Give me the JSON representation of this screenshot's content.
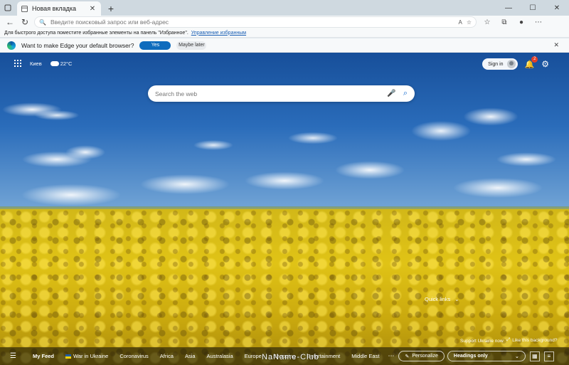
{
  "browser": {
    "tab_title": "Новая вкладка",
    "address_placeholder": "Введите поисковый запрос или веб-адрес",
    "favorites_hint": "Для быстрого доступа поместите избранные элементы на панель \"Избранное\".",
    "favorites_link": "Управление избранным"
  },
  "default_prompt": {
    "text": "Want to make Edge your default browser?",
    "yes_label": "Yes",
    "later_label": "Maybe later"
  },
  "ntp": {
    "city": "Киев",
    "temperature": "22°C",
    "signin_label": "Sign in",
    "notification_count": "2",
    "search_placeholder": "Search the web",
    "quick_links": "Quick links",
    "support_text": "Support Ukraine now",
    "like_bg_text": "Like this background?"
  },
  "feed": {
    "tabs": [
      "My Feed",
      "War in Ukraine",
      "Coronavirus",
      "Africa",
      "Asia",
      "Australasia",
      "Europe",
      "Shopping",
      "Entertainment",
      "Middle East"
    ],
    "personalize_label": "Personalize",
    "headings_value": "Headings only"
  },
  "watermark": "NaName-Club",
  "icons": {
    "back": "back-arrow-icon",
    "reload": "reload-icon",
    "info": "info-icon",
    "read_aloud": "read-aloud-icon",
    "favorite": "star-icon",
    "apps": "apps-grid-icon",
    "weather": "partly-cloudy-icon",
    "bell": "bell-icon",
    "settings": "gear-icon",
    "mic": "microphone-icon",
    "search": "search-icon"
  }
}
